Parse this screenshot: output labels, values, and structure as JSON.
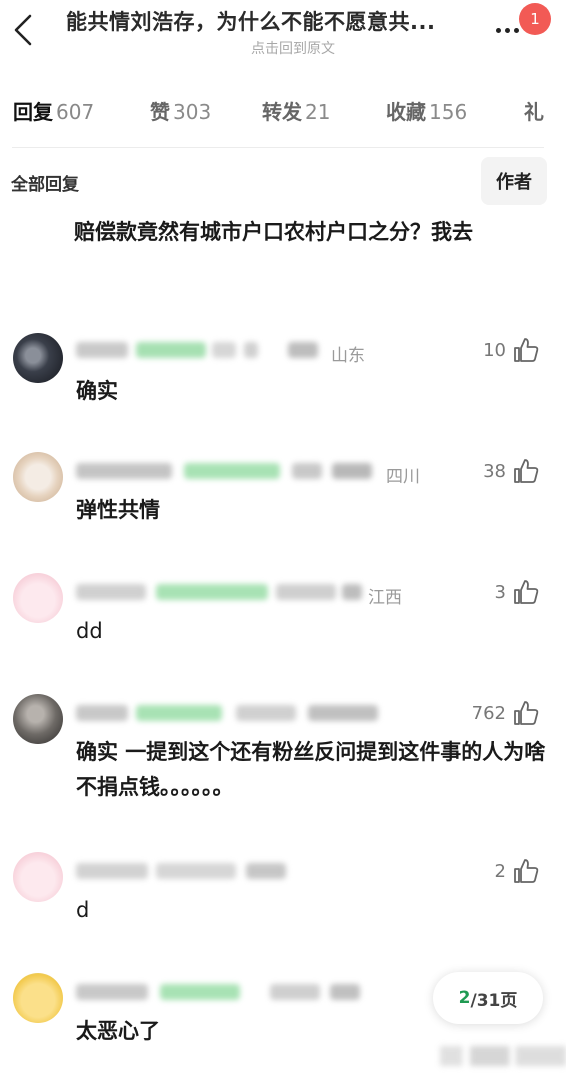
{
  "header": {
    "title": "能共情刘浩存，为什么不能不愿意共...",
    "subtitle": "点击回到原文",
    "notification_count": "1"
  },
  "tabs": [
    {
      "label": "回复",
      "count": "607",
      "active": true
    },
    {
      "label": "赞",
      "count": "303",
      "active": false
    },
    {
      "label": "转发",
      "count": "21",
      "active": false
    },
    {
      "label": "收藏",
      "count": "156",
      "active": false
    },
    {
      "label": "礼",
      "count": "",
      "active": false
    }
  ],
  "filter": {
    "all_replies_label": "全部回复",
    "author_button": "作者"
  },
  "op_text": "赔偿款竟然有城市户口农村户口之分？我去",
  "replies": [
    {
      "location": "山东",
      "likes": "10",
      "text": "确实",
      "avatar": "dark-photo-avatar"
    },
    {
      "location": "四川",
      "likes": "38",
      "text": "弹性共情",
      "avatar": "puppy-avatar"
    },
    {
      "location": "江西",
      "likes": "3",
      "text": "dd",
      "avatar": "pink-cartoon-avatar"
    },
    {
      "location": "",
      "likes": "762",
      "text": "确实 一提到这个还有粉丝反问提到这件事的人为啥不捐点钱。。。。。。",
      "avatar": "photo-avatar"
    },
    {
      "location": "",
      "likes": "2",
      "text": "d",
      "avatar": "pink-cartoon-avatar"
    },
    {
      "location": "",
      "likes": "",
      "text": "太恶心了",
      "avatar": "yellow-cartoon-avatar"
    }
  ],
  "pagination": {
    "current": "2",
    "total": "/31页"
  },
  "colors": {
    "accent_green": "#1f9a52",
    "badge_red": "#f25a55"
  }
}
